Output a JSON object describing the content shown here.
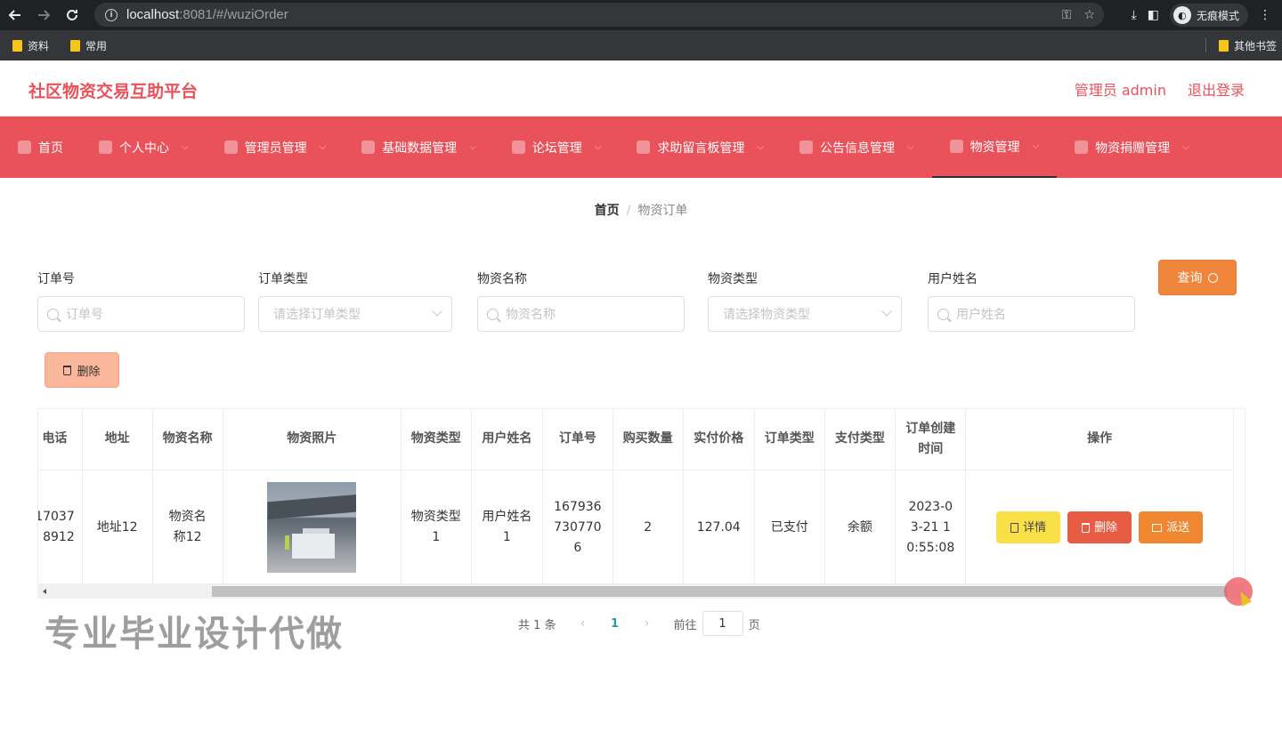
{
  "browser": {
    "url_host": "localhost",
    "url_rest": ":8081/#/wuziOrder",
    "incognito_label": "无痕模式",
    "bookmarks": [
      "资料",
      "常用"
    ],
    "bookmarks_right": "其他书签"
  },
  "header": {
    "title": "社区物资交易互助平台",
    "user": "管理员 admin",
    "logout": "退出登录"
  },
  "menu": [
    {
      "label": "首页",
      "icon": "home-icon"
    },
    {
      "label": "个人中心",
      "icon": "user-icon"
    },
    {
      "label": "管理员管理",
      "icon": "send-icon"
    },
    {
      "label": "基础数据管理",
      "icon": "grid-icon"
    },
    {
      "label": "论坛管理",
      "icon": "user-icon"
    },
    {
      "label": "求助留言板管理",
      "icon": "doc-icon"
    },
    {
      "label": "公告信息管理",
      "icon": "house-icon"
    },
    {
      "label": "物资管理",
      "icon": "location-icon"
    },
    {
      "label": "物资捐赠管理",
      "icon": "tag-icon"
    }
  ],
  "breadcrumb": {
    "home": "首页",
    "sep": "/",
    "current": "物资订单"
  },
  "search": {
    "order_no_label": "订单号",
    "order_no_placeholder": "订单号",
    "order_type_label": "订单类型",
    "order_type_placeholder": "请选择订单类型",
    "goods_name_label": "物资名称",
    "goods_name_placeholder": "物资名称",
    "goods_type_label": "物资类型",
    "goods_type_placeholder": "请选择物资类型",
    "user_name_label": "用户姓名",
    "user_name_placeholder": "用户姓名",
    "query_button": "查询",
    "delete_button": "删除"
  },
  "table": {
    "headers": [
      "电话",
      "地址",
      "物资名称",
      "物资照片",
      "物资类型",
      "用户姓名",
      "订单号",
      "购买数量",
      "实付价格",
      "订单类型",
      "支付类型",
      "订单创建时间",
      "操作"
    ],
    "row": {
      "phone": "170378912",
      "address": "地址12",
      "goods_name": "物资名称12",
      "goods_type": "物资类型1",
      "user_name": "用户姓名1",
      "order_no": "1679367307706",
      "quantity": "2",
      "price": "127.04",
      "order_type": "已支付",
      "pay_type": "余额",
      "created_at": "2023-03-21 10:55:08"
    },
    "actions": {
      "detail": "详情",
      "delete": "删除",
      "dispatch": "派送"
    }
  },
  "pagination": {
    "total": "共 1 条",
    "page": "1",
    "goto": "前往",
    "goto_value": "1",
    "suffix": "页"
  },
  "watermark": "专业毕业设计代做",
  "colors": {
    "primary": "#e9525a",
    "query": "#f0863c",
    "detail": "#fae047",
    "delete": "#e85c43",
    "dispatch": "#f0862f"
  }
}
